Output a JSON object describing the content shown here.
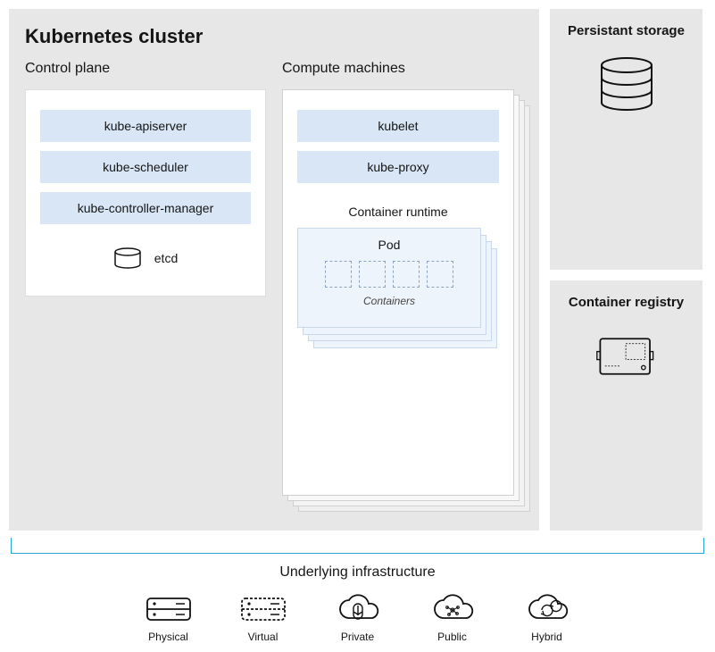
{
  "cluster": {
    "title": "Kubernetes cluster",
    "control_plane": {
      "heading": "Control plane",
      "components": [
        "kube-apiserver",
        "kube-scheduler",
        "kube-controller-manager"
      ],
      "etcd_label": "etcd"
    },
    "compute": {
      "heading": "Compute machines",
      "components": [
        "kubelet",
        "kube-proxy"
      ],
      "runtime_title": "Container runtime",
      "pod_title": "Pod",
      "containers_label": "Containers",
      "container_count": 4
    }
  },
  "side": {
    "storage_title": "Persistant storage",
    "registry_title": "Container registry"
  },
  "infra": {
    "title": "Underlying infrastructure",
    "items": [
      "Physical",
      "Virtual",
      "Private",
      "Public",
      "Hybrid"
    ]
  },
  "colors": {
    "panel_bg": "#e7e7e7",
    "chip_bg": "#d8e6f6",
    "pod_bg": "#eef4fb",
    "bracket": "#2aa3d6"
  }
}
